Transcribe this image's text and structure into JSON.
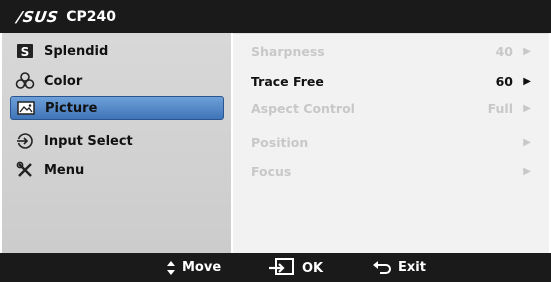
{
  "title": {
    "brand": "/SUS",
    "model": "CP240"
  },
  "menu": [
    {
      "label": "Splendid",
      "icon": "splendid-s-icon",
      "selected": false
    },
    {
      "label": "Color",
      "icon": "color-circles-icon",
      "selected": false
    },
    {
      "label": "Picture",
      "icon": "picture-icon",
      "selected": true
    },
    {
      "label": "Input Select",
      "icon": "input-select-icon",
      "selected": false
    },
    {
      "label": "Menu",
      "icon": "tools-icon",
      "selected": false
    }
  ],
  "settings": [
    {
      "name": "Sharpness",
      "value": "40",
      "active": false
    },
    {
      "name": "Trace Free",
      "value": "60",
      "active": true
    },
    {
      "name": "Aspect Control",
      "value": "Full",
      "active": false
    },
    {
      "name": "Position",
      "value": "",
      "active": false
    },
    {
      "name": "Focus",
      "value": "",
      "active": false
    }
  ],
  "footer": {
    "move": "Move",
    "ok": "OK",
    "exit": "Exit"
  },
  "colors": {
    "bar": "#1a1a1a",
    "selected": "#4a80c4",
    "panel": "#d0d0d0",
    "disabled": "#c8c8c8"
  }
}
